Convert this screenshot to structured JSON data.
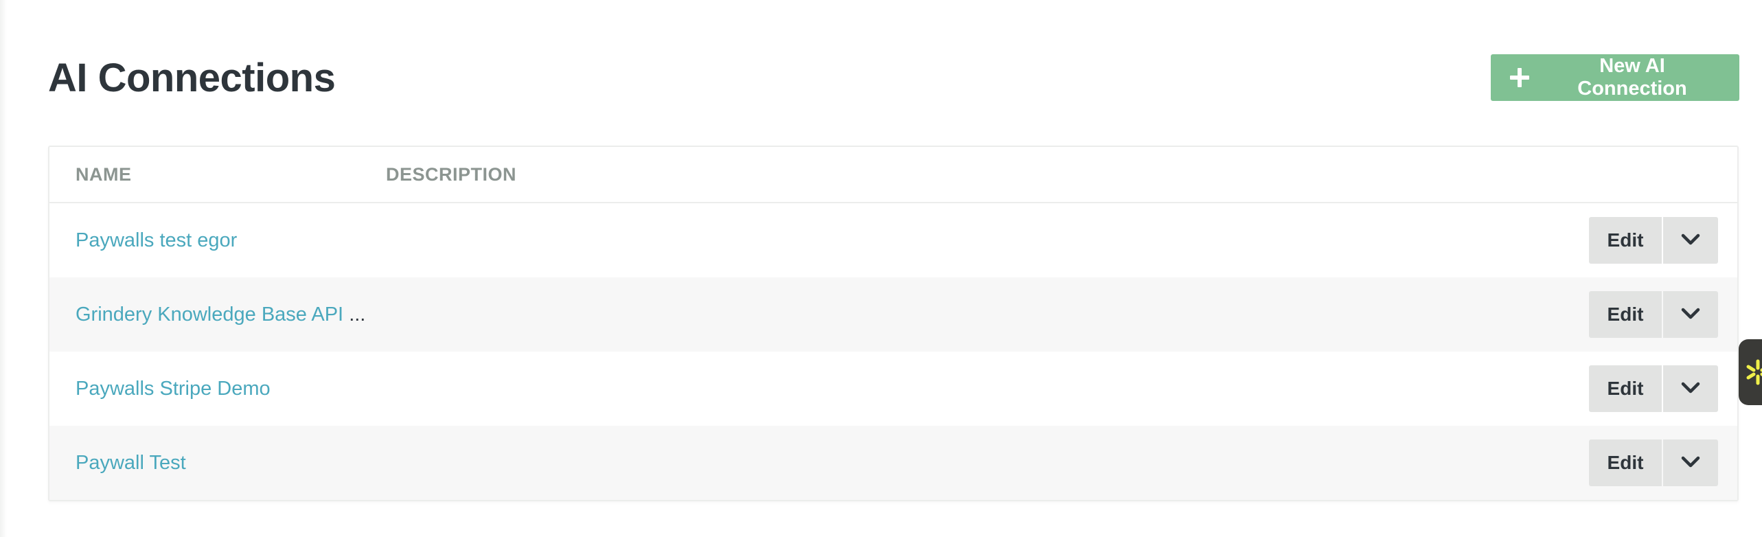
{
  "header": {
    "title": "AI Connections",
    "new_button_label": "New AI Connection"
  },
  "table": {
    "columns": [
      "NAME",
      "DESCRIPTION"
    ],
    "rows": [
      {
        "name": "Paywalls test egor",
        "truncated": false
      },
      {
        "name": "Grindery Knowledge Base API",
        "truncated": true
      },
      {
        "name": "Paywalls Stripe Demo",
        "truncated": false
      },
      {
        "name": "Paywall Test",
        "truncated": false
      }
    ],
    "edit_label": "Edit",
    "ellipsis": "..."
  },
  "icons": {
    "new_button": "plus-icon",
    "row_menu": "chevron-down-icon",
    "side_widget": "sparkle-icon"
  },
  "colors": {
    "primary_button": "#80c193",
    "link": "#4aa8bd",
    "title": "#2e353b",
    "header_text": "#8c9591",
    "action_button_bg": "#e2e3e2",
    "widget_bg": "#3a3a37",
    "widget_accent": "#f0f04a"
  }
}
